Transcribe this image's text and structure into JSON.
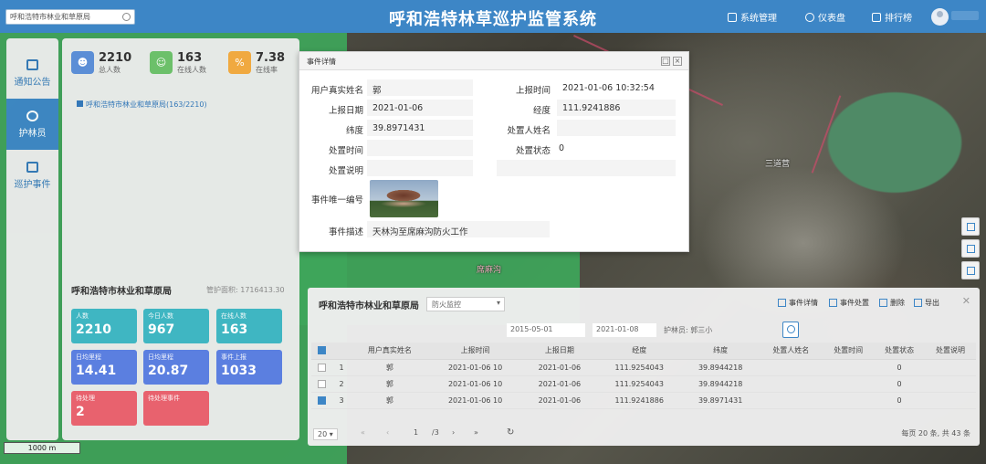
{
  "header": {
    "title": "呼和浩特林草巡护监管系统",
    "search_value": "呼和浩特市林业和草原局",
    "nav": [
      {
        "label": "系统管理",
        "icon": "home-icon"
      },
      {
        "label": "仪表盘",
        "icon": "dashboard-icon"
      },
      {
        "label": "排行榜",
        "icon": "ranking-icon"
      }
    ]
  },
  "sidebar": {
    "items": [
      {
        "label": "通知公告",
        "icon": "notice-icon",
        "active": false
      },
      {
        "label": "护林员",
        "icon": "ranger-icon",
        "active": true
      },
      {
        "label": "巡护事件",
        "icon": "event-icon",
        "active": false
      }
    ]
  },
  "left_panel": {
    "stats": [
      {
        "value": "2210",
        "label": "总人数",
        "color": "#5b8ed6",
        "icon": "users-icon"
      },
      {
        "value": "163",
        "label": "在线人数",
        "color": "#6cc06a",
        "icon": "person-icon"
      },
      {
        "value": "7.38",
        "label": "在线率",
        "color": "#f0a940",
        "icon": "rate-icon"
      }
    ],
    "tree_node": "呼和浩特市林业和草原局(163/2210)",
    "org_title": "呼和浩特市林业和草原局",
    "area_label": "管护面积: 1716413.30",
    "cards": [
      {
        "label": "人数",
        "value": "2210",
        "color": "#3fb6c2"
      },
      {
        "label": "今日人数",
        "value": "967",
        "color": "#3fb6c2"
      },
      {
        "label": "在线人数",
        "value": "163",
        "color": "#3fb6c2"
      },
      {
        "label": "日均里程",
        "value": "14.41",
        "color": "#5b7fe0"
      },
      {
        "label": "日均里程",
        "value": "20.87",
        "color": "#5b7fe0"
      },
      {
        "label": "事件上报",
        "value": "1033",
        "color": "#5b7fe0"
      },
      {
        "label": "待处理",
        "value": "2",
        "color": "#e8626e"
      },
      {
        "label": "待处理事件",
        "value": "",
        "color": "#e8626e"
      }
    ]
  },
  "dialog": {
    "title": "事件详情",
    "fields": {
      "username_label": "用户真实姓名",
      "username_value": "郭",
      "report_time_label": "上报时间",
      "report_time_value": "2021-01-06 10:32:54",
      "report_date_label": "上报日期",
      "report_date_value": "2021-01-06",
      "longitude_label": "经度",
      "longitude_value": "111.9241886",
      "latitude_label": "纬度",
      "latitude_value": "39.8971431",
      "handler_label": "处置人姓名",
      "handler_value": "",
      "handle_time_label": "处置时间",
      "handle_time_value": "",
      "handle_status_label": "处置状态",
      "handle_status_value": "0",
      "handle_desc_label": "处置说明",
      "event_id_label": "事件唯一编号",
      "event_desc_label": "事件描述",
      "event_desc_value": "天林沟至席麻沟防火工作"
    }
  },
  "bottom_panel": {
    "title": "呼和浩特市林业和草原局",
    "select_value": "防火监控",
    "tools": [
      "事件详情",
      "事件处置",
      "删除",
      "导出"
    ],
    "date_start": "2015-05-01",
    "date_end": "2021-01-08",
    "ranger_label": "护林员:",
    "ranger_value": "郭三小",
    "columns": [
      "用户真实姓名",
      "上报时间",
      "上报日期",
      "经度",
      "纬度",
      "处置人姓名",
      "处置时间",
      "处置状态",
      "处置说明"
    ],
    "rows": [
      {
        "idx": "1",
        "checked": false,
        "name": "郭",
        "time": "2021-01-06 10",
        "date": "2021-01-06",
        "lng": "111.9254043",
        "lat": "39.8944218",
        "handler": "",
        "htime": "",
        "status": "0",
        "desc": ""
      },
      {
        "idx": "2",
        "checked": false,
        "name": "郭",
        "time": "2021-01-06 10",
        "date": "2021-01-06",
        "lng": "111.9254043",
        "lat": "39.8944218",
        "handler": "",
        "htime": "",
        "status": "0",
        "desc": ""
      },
      {
        "idx": "3",
        "checked": true,
        "name": "郭",
        "time": "2021-01-06 10",
        "date": "2021-01-06",
        "lng": "111.9241886",
        "lat": "39.8971431",
        "handler": "",
        "htime": "",
        "status": "0",
        "desc": ""
      }
    ],
    "pager": {
      "page_size": "20",
      "page": "1",
      "total_pages": "/3",
      "summary": "每页 20 条, 共 43 条"
    }
  },
  "map": {
    "scale": "1000 m",
    "labels": [
      "三道营",
      "席麻沟"
    ]
  }
}
